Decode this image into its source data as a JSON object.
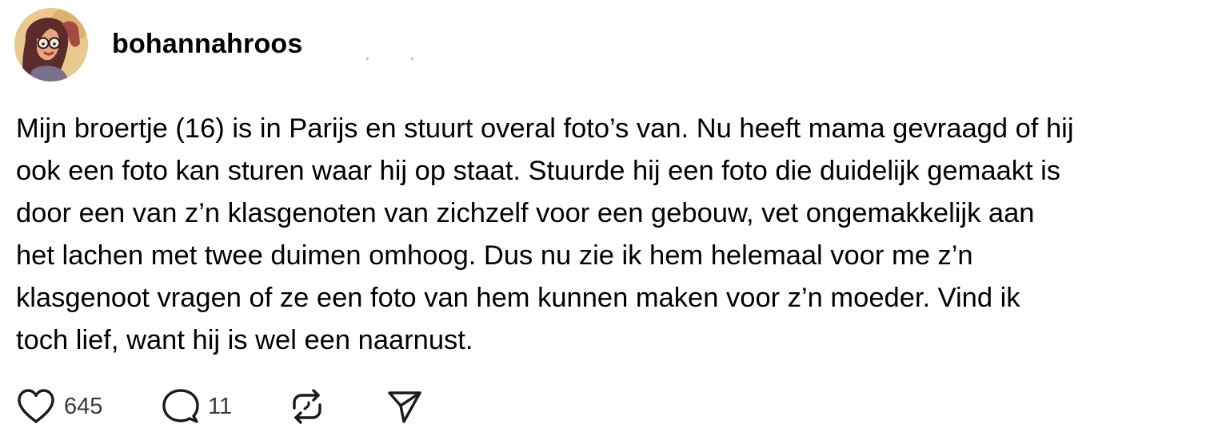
{
  "post": {
    "username": "bohannahroos",
    "text": "Mijn broertje (16) is in Parijs en stuurt overal foto’s van. Nu heeft mama gevraagd of hij\nook een foto kan sturen waar hij op staat. Stuurde hij een foto die duidelijk gemaakt is\ndoor een van z’n klasgenoten van zichzelf voor een gebouw, vet ongemakkelijk aan\nhet lachen met twee duimen omhoog. Dus nu zie ik hem helemaal voor me z’n\nklasgenoot vragen of ze een foto van hem kunnen maken voor z’n moeder. Vind ik\ntoch lief, want hij is wel een naarnust.",
    "avatar_icon": "cartoon-portrait-avatar",
    "actions": {
      "likes": "645",
      "comments": "11",
      "like_icon": "heart-icon",
      "comment_icon": "speech-bubble-icon",
      "repost_icon": "repost-icon",
      "share_icon": "send-icon"
    }
  },
  "colors": {
    "text": "#000000",
    "count_text": "#3a3a3a",
    "icon_stroke": "#1a1a1a",
    "avatar_bg": "#e9c98f"
  }
}
